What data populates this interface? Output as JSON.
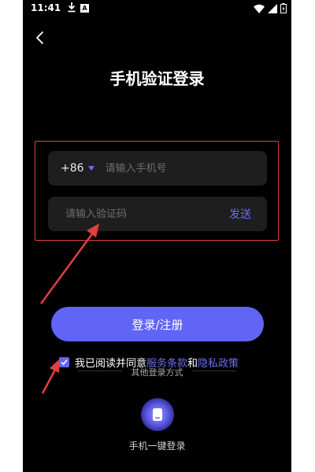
{
  "status_bar": {
    "time": "11:41",
    "download_icon": "download-icon",
    "notification_badge": "A",
    "icons": [
      "wifi-icon",
      "signal-icon",
      "battery-icon"
    ]
  },
  "header": {
    "back_icon": "chevron-left-icon",
    "title": "手机验证登录"
  },
  "form": {
    "country_code": "+86",
    "phone_placeholder": "请输入手机号",
    "code_placeholder": "请输入验证码",
    "send_label": "发送"
  },
  "login_button": {
    "label": "登录/注册"
  },
  "agreement": {
    "checked": true,
    "prefix": "我已阅读并同意",
    "terms_link": "服务条款",
    "and": "和",
    "privacy_link": "隐私政策"
  },
  "other_methods": {
    "label": "其他登录方式",
    "onekey_label": "手机一键登录",
    "onekey_icon": "phone-icon"
  },
  "colors": {
    "background": "#000000",
    "accent": "#6165f5",
    "input_bg": "#1e1e1e",
    "annotation_red": "#e04040"
  }
}
